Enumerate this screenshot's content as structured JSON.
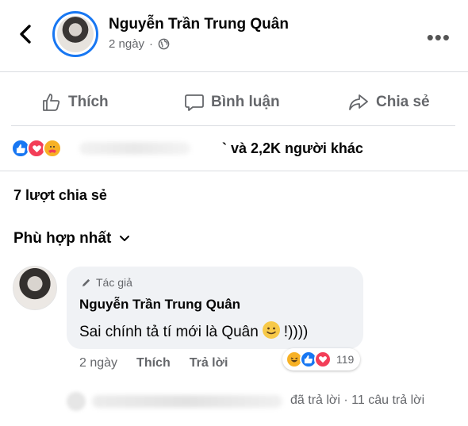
{
  "header": {
    "author_name": "Nguyễn Trần Trung Quân",
    "time": "2 ngày",
    "separator": "·",
    "more_label": "•••"
  },
  "actions": {
    "like": "Thích",
    "comment": "Bình luận",
    "share": "Chia sẻ"
  },
  "reactions": {
    "icons": [
      "like-reaction",
      "love-reaction",
      "care-reaction"
    ],
    "summary": "` và 2,2K người khác"
  },
  "shares": "7 lượt chia sẻ",
  "sort": {
    "label": "Phù hợp nhất"
  },
  "comment": {
    "author_badge": "Tác giả",
    "name": "Nguyễn Trần Trung Quân",
    "text_before": "Sai chính tả tí mới là Quân",
    "text_after": "!))))",
    "reaction_count": "119",
    "time": "2 ngày",
    "like": "Thích",
    "reply": "Trả lời"
  },
  "replies": {
    "text": "đã trả lời · 11 câu trả lời"
  },
  "colors": {
    "facebook_blue": "#1877f2",
    "love_red": "#f33e58",
    "care_yellow": "#f7b125",
    "secondary_text": "#65676b"
  }
}
